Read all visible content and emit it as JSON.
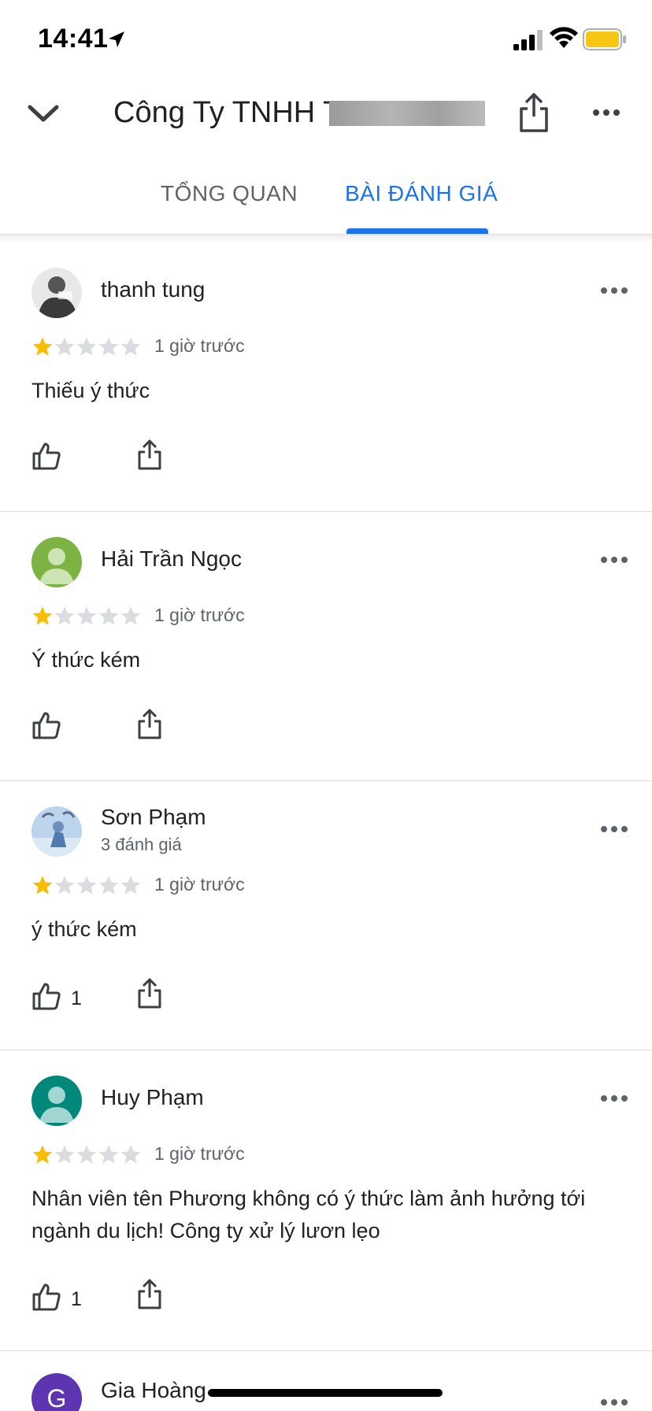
{
  "status_bar": {
    "time": "14:41"
  },
  "header": {
    "title": "Công Ty TNHH T"
  },
  "tabs": [
    {
      "label": "TỔNG QUAN",
      "selected": false
    },
    {
      "label": "BÀI ĐÁNH GIÁ",
      "selected": true
    }
  ],
  "colors": {
    "accent": "#1a73e8",
    "star": "#fbbc04",
    "star_empty": "#dadce0"
  },
  "reviews": [
    {
      "name": "thanh tung",
      "subtitle": "",
      "rating": 1,
      "time": "1 giờ trước",
      "text": "Thiếu ý thức",
      "likes": ""
    },
    {
      "name": "Hải Trần Ngọc",
      "subtitle": "",
      "rating": 1,
      "time": "1 giờ trước",
      "text": "Ý thức kém",
      "likes": ""
    },
    {
      "name": "Sơn Phạm",
      "subtitle": "3 đánh giá",
      "rating": 1,
      "time": "1 giờ trước",
      "text": "ý thức kém",
      "likes": "1"
    },
    {
      "name": "Huy Phạm",
      "subtitle": "",
      "rating": 1,
      "time": "1 giờ trước",
      "text": "Nhân viên tên Phương không có ý thức làm ảnh hưởng tới ngành du lịch! Công ty xử lý lươn lẹo",
      "likes": "1"
    },
    {
      "name": "Gia Hoàng",
      "subtitle": "",
      "avatar_letter": "G"
    }
  ]
}
